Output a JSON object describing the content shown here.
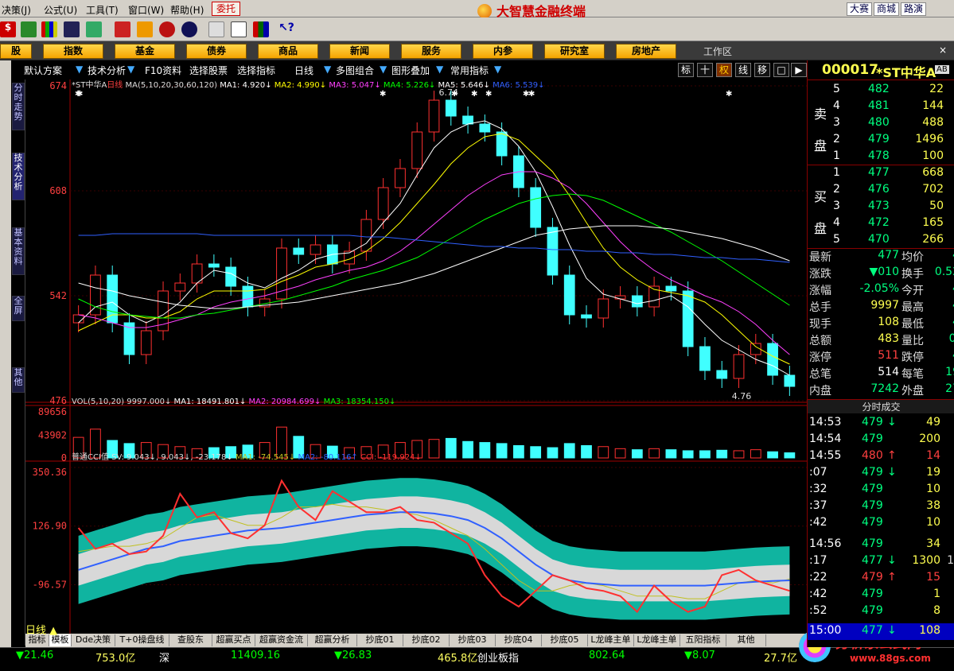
{
  "menu": {
    "items": [
      "决策(J)",
      "公式(U)",
      "工具(T)",
      "窗口(W)",
      "帮助(H)"
    ],
    "entrust": "委托",
    "brand": "大智慧金融终端",
    "right_buttons": [
      "大赛",
      "商城",
      "路演"
    ]
  },
  "nav": {
    "items": [
      "股",
      "指数",
      "基金",
      "债券",
      "商品",
      "新闻",
      "服务",
      "内参",
      "研究室",
      "房地产"
    ],
    "workarea": "工作区"
  },
  "subbar": {
    "items": [
      "默认方案",
      "技术分析",
      "F10资料",
      "选择股票",
      "选择指标",
      "日线",
      "多图组合",
      "图形叠加",
      "常用指标"
    ],
    "right_icons": [
      "标",
      "十",
      "权",
      "线",
      "移",
      "□",
      "▶"
    ]
  },
  "lefttabs": [
    "分时走势",
    "技术分析",
    "基本资料",
    "全屏",
    "其他"
  ],
  "chart": {
    "title_text": "*ST中华A",
    "period": "日线",
    "ma_header": "MA(5,10,20,30,60,120)",
    "ma_values": [
      {
        "label": "MA1: 4.920↓",
        "color": "#ffffff"
      },
      {
        "label": "MA2: 4.990↓",
        "color": "#ffff00"
      },
      {
        "label": "MA3: 5.047↓",
        "color": "#ff40ff"
      },
      {
        "label": "MA4: 5.226↓",
        "color": "#00ff00"
      },
      {
        "label": "MA5: 5.646↓",
        "color": "#ffffff"
      },
      {
        "label": "MA6: 5.539↓",
        "color": "#3060ff"
      }
    ],
    "price_axis": [
      "674",
      "608",
      "542",
      "476"
    ],
    "high_label": "6.74",
    "low_label": "4.76",
    "vol_header": "VOL(5,10,20)  9997.000↓",
    "vol_values": [
      {
        "label": "MA1: 18491.801↓",
        "color": "#ffffff"
      },
      {
        "label": "MA2: 20984.699↓",
        "color": "#ff40ff"
      },
      {
        "label": "MA3: 18354.150↓",
        "color": "#00ff00"
      }
    ],
    "vol_axis": [
      "89656",
      "43902",
      "0"
    ],
    "cci_header": "普通CCI值  SV: 9.043↓, 9.043↓, -23.178↓",
    "cci_values": [
      {
        "label": "MA1: -74.545↓",
        "color": "#c0c020"
      },
      {
        "label": "MA2: -80.116↑",
        "color": "#3060ff"
      },
      {
        "label": "CCI: -119.924↓",
        "color": "#ff3030"
      }
    ],
    "cci_axis": [
      "350.36",
      "126.90",
      "-96.57",
      "-316.37"
    ],
    "date_labels": [
      "2011/01",
      "02",
      "03",
      "04",
      "05",
      "06"
    ]
  },
  "chart_data": {
    "type": "line",
    "title": "*ST中华A 日线",
    "ylim": [
      4.76,
      6.74
    ],
    "close": [
      5.3,
      5.55,
      5.25,
      5.05,
      5.2,
      5.45,
      5.5,
      5.62,
      5.6,
      5.48,
      5.35,
      5.4,
      5.72,
      5.68,
      5.74,
      5.62,
      5.7,
      5.9,
      6.1,
      6.22,
      6.45,
      6.65,
      6.55,
      6.5,
      6.45,
      6.3,
      6.1,
      5.85,
      5.55,
      5.3,
      5.28,
      5.4,
      5.42,
      5.35,
      5.48,
      5.45,
      5.1,
      4.95,
      4.9,
      5.05,
      5.12,
      4.92,
      4.85
    ],
    "series": [
      {
        "name": "MA1",
        "values": [
          5.25,
          5.35,
          5.38,
          5.3,
          5.25,
          5.3,
          5.38,
          5.5,
          5.58,
          5.56,
          5.5,
          5.47,
          5.53,
          5.58,
          5.65,
          5.68,
          5.69,
          5.75,
          5.88,
          6.0,
          6.18,
          6.35,
          6.45,
          6.5,
          6.52,
          6.47,
          6.36,
          6.2,
          5.98,
          5.74,
          5.53,
          5.43,
          5.4,
          5.37,
          5.39,
          5.42,
          5.35,
          5.24,
          5.14,
          5.08,
          5.02,
          4.98,
          4.92
        ]
      },
      {
        "name": "MA2",
        "values": [
          5.2,
          5.25,
          5.3,
          5.3,
          5.28,
          5.28,
          5.32,
          5.4,
          5.45,
          5.45,
          5.45,
          5.46,
          5.51,
          5.55,
          5.6,
          5.62,
          5.65,
          5.7,
          5.78,
          5.88,
          6.0,
          6.12,
          6.25,
          6.35,
          6.42,
          6.44,
          6.4,
          6.3,
          6.2,
          6.05,
          5.88,
          5.72,
          5.6,
          5.52,
          5.46,
          5.44,
          5.42,
          5.38,
          5.3,
          5.2,
          5.1,
          5.04,
          4.99
        ]
      },
      {
        "name": "MA3",
        "values": [
          5.3,
          5.28,
          5.25,
          5.22,
          5.22,
          5.24,
          5.27,
          5.3,
          5.35,
          5.38,
          5.4,
          5.42,
          5.45,
          5.48,
          5.52,
          5.55,
          5.58,
          5.6,
          5.64,
          5.7,
          5.78,
          5.87,
          5.96,
          6.05,
          6.12,
          6.18,
          6.2,
          6.2,
          6.16,
          6.1,
          6.0,
          5.88,
          5.76,
          5.66,
          5.58,
          5.52,
          5.47,
          5.42,
          5.38,
          5.32,
          5.24,
          5.14,
          5.05
        ]
      },
      {
        "name": "MA4",
        "values": [
          5.4,
          5.35,
          5.32,
          5.3,
          5.29,
          5.28,
          5.28,
          5.3,
          5.31,
          5.33,
          5.35,
          5.37,
          5.39,
          5.42,
          5.45,
          5.48,
          5.52,
          5.55,
          5.58,
          5.62,
          5.66,
          5.72,
          5.78,
          5.84,
          5.9,
          5.95,
          6.0,
          6.03,
          6.05,
          6.06,
          6.05,
          6.02,
          5.97,
          5.92,
          5.87,
          5.82,
          5.76,
          5.7,
          5.64,
          5.57,
          5.5,
          5.43,
          5.36
        ]
      },
      {
        "name": "MA5",
        "values": [
          5.5,
          5.47,
          5.45,
          5.42,
          5.4,
          5.38,
          5.36,
          5.35,
          5.34,
          5.34,
          5.35,
          5.36,
          5.37,
          5.38,
          5.4,
          5.42,
          5.44,
          5.46,
          5.48,
          5.5,
          5.53,
          5.56,
          5.6,
          5.64,
          5.68,
          5.72,
          5.76,
          5.8,
          5.82,
          5.84,
          5.85,
          5.86,
          5.86,
          5.86,
          5.85,
          5.84,
          5.82,
          5.8,
          5.78,
          5.75,
          5.72,
          5.68,
          5.64
        ]
      },
      {
        "name": "MA6",
        "values": [
          5.8,
          5.8,
          5.81,
          5.81,
          5.81,
          5.81,
          5.81,
          5.81,
          5.8,
          5.8,
          5.8,
          5.8,
          5.8,
          5.8,
          5.8,
          5.8,
          5.8,
          5.79,
          5.79,
          5.78,
          5.77,
          5.76,
          5.75,
          5.74,
          5.73,
          5.73,
          5.72,
          5.72,
          5.71,
          5.71,
          5.7,
          5.7,
          5.69,
          5.69,
          5.68,
          5.68,
          5.67,
          5.66,
          5.66,
          5.65,
          5.65,
          5.64,
          5.63
        ]
      }
    ],
    "volume": [
      40000,
      56000,
      34000,
      28000,
      30000,
      26000,
      22000,
      18000,
      20000,
      22000,
      25000,
      30000,
      60000,
      42000,
      26000,
      23000,
      20000,
      22000,
      25000,
      30000,
      34000,
      36000,
      38000,
      32000,
      30000,
      28000,
      24000,
      22000,
      20000,
      28000,
      24000,
      22000,
      18000,
      16000,
      18000,
      16000,
      14000,
      14000,
      15000,
      14000,
      16000,
      12000,
      9997
    ],
    "volume_ylim": [
      0,
      89656
    ],
    "cci": [
      120,
      40,
      60,
      20,
      30,
      90,
      250,
      160,
      180,
      100,
      80,
      130,
      300,
      200,
      150,
      260,
      220,
      180,
      180,
      200,
      150,
      140,
      100,
      60,
      -60,
      -140,
      -180,
      -120,
      -60,
      -80,
      -110,
      -120,
      -140,
      -200,
      -100,
      -160,
      -200,
      -180,
      -60,
      -40,
      -80,
      -100,
      -120
    ],
    "cci_ma1": [
      30,
      40,
      50,
      50,
      60,
      80,
      120,
      160,
      170,
      150,
      130,
      130,
      160,
      200,
      200,
      210,
      200,
      200,
      190,
      180,
      170,
      150,
      120,
      90,
      40,
      -20,
      -80,
      -120,
      -120,
      -100,
      -90,
      -100,
      -120,
      -140,
      -140,
      -140,
      -150,
      -150,
      -120,
      -90,
      -80,
      -90,
      -75
    ],
    "cci_ma2": [
      -40,
      -20,
      0,
      20,
      40,
      50,
      70,
      80,
      90,
      100,
      110,
      115,
      120,
      130,
      140,
      150,
      160,
      170,
      175,
      180,
      180,
      175,
      165,
      150,
      120,
      80,
      30,
      -20,
      -60,
      -80,
      -90,
      -95,
      -100,
      -100,
      -100,
      -100,
      -100,
      -100,
      -95,
      -90,
      -85,
      -82,
      -80
    ],
    "cci_ylim": [
      -316.37,
      350.36
    ],
    "x_labels": [
      "2011/01",
      "02",
      "03",
      "04",
      "05",
      "06"
    ]
  },
  "quote": {
    "code": "000017",
    "name": "*ST中华A",
    "tag": "AB",
    "sell_label": [
      "卖",
      "盘"
    ],
    "buy_label": [
      "买",
      "盘"
    ],
    "sell": [
      {
        "lv": "5",
        "p": "482",
        "v": "22"
      },
      {
        "lv": "4",
        "p": "481",
        "v": "144"
      },
      {
        "lv": "3",
        "p": "480",
        "v": "488"
      },
      {
        "lv": "2",
        "p": "479",
        "v": "1496"
      },
      {
        "lv": "1",
        "p": "478",
        "v": "100"
      }
    ],
    "buy": [
      {
        "lv": "1",
        "p": "477",
        "v": "668"
      },
      {
        "lv": "2",
        "p": "476",
        "v": "702"
      },
      {
        "lv": "3",
        "p": "473",
        "v": "50"
      },
      {
        "lv": "4",
        "p": "472",
        "v": "165"
      },
      {
        "lv": "5",
        "p": "470",
        "v": "266"
      }
    ],
    "stats": [
      {
        "k1": "最新",
        "v1": "477",
        "k2": "均价",
        "v2": "4"
      },
      {
        "k1": "涨跌",
        "v1": "▼010",
        "k2": "换手",
        "v2": "0.52"
      },
      {
        "k1": "涨幅",
        "v1": "-2.05%",
        "k2": "今开",
        "v2": "4"
      },
      {
        "k1": "总手",
        "v1": "9997",
        "k2": "最高",
        "v2": "4"
      },
      {
        "k1": "现手",
        "v1": "108",
        "k2": "最低",
        "v2": "4"
      },
      {
        "k1": "总额",
        "v1": "483",
        "k2": "量比",
        "v2": "0."
      },
      {
        "k1": "涨停",
        "v1": "511",
        "k2": "跌停",
        "v2": "4"
      },
      {
        "k1": "总笔",
        "v1": "514",
        "k2": "每笔",
        "v2": "19"
      },
      {
        "k1": "内盘",
        "v1": "7242",
        "k2": "外盘",
        "v2": "27"
      }
    ],
    "ticks_header": "分时成交",
    "ticks": [
      {
        "t": "14:53",
        "p": "479",
        "a": "↓",
        "v": "49",
        "x": "1"
      },
      {
        "t": "14:54",
        "p": "479",
        "a": "",
        "v": "200",
        "x": "2"
      },
      {
        "t": "14:55",
        "p": "480",
        "a": "↑",
        "v": "14",
        "x": "2"
      },
      {
        "t": ":07",
        "p": "479",
        "a": "↓",
        "v": "19",
        "x": "2"
      },
      {
        "t": ":32",
        "p": "479",
        "a": "",
        "v": "10",
        "x": "3"
      },
      {
        "t": ":37",
        "p": "479",
        "a": "",
        "v": "38",
        "x": "1"
      },
      {
        "t": ":42",
        "p": "479",
        "a": "",
        "v": "10",
        "x": "1"
      },
      {
        "t": "14:56",
        "p": "479",
        "a": "",
        "v": "34",
        "x": "2"
      },
      {
        "t": ":17",
        "p": "477",
        "a": "↓",
        "v": "1300",
        "x": "18"
      },
      {
        "t": ":22",
        "p": "479",
        "a": "↑",
        "v": "15",
        "x": "1"
      },
      {
        "t": ":42",
        "p": "479",
        "a": "",
        "v": "1",
        "x": "1"
      },
      {
        "t": ":52",
        "p": "479",
        "a": "",
        "v": "8",
        "x": "1"
      },
      {
        "t": "15:00",
        "p": "477",
        "a": "↓",
        "v": "108",
        "x": "9"
      }
    ]
  },
  "bottom_tabs": [
    "指标",
    "模板",
    "Dde决策",
    "T+0操盘线",
    "查股东",
    "超赢买点",
    "超赢资金流",
    "超赢分析",
    "抄底01",
    "抄底02",
    "抄底03",
    "抄底04",
    "抄底05",
    "L龙峰主单1",
    "L龙峰主单2",
    "五阳指标",
    "其他"
  ],
  "status": {
    "items": [
      {
        "t": "▼21.46",
        "c": "#00ff00"
      },
      {
        "t": "753.0亿",
        "c": "#ffff60"
      },
      {
        "t": "深",
        "c": "#ffffff"
      },
      {
        "t": "11409.16",
        "c": "#00ff00"
      },
      {
        "t": "▼26.83",
        "c": "#00ff00"
      },
      {
        "t": "465.8亿",
        "c": "#ffff60"
      },
      {
        "t": "创业板指",
        "c": "#ffffff"
      },
      {
        "t": "802.64",
        "c": "#00ff00"
      },
      {
        "t": "▼8.07",
        "c": "#00ff00"
      },
      {
        "t": "27.7亿",
        "c": "#ffff60"
      }
    ],
    "watermark1": "分析家公式网",
    "watermark2": "www.88gs.com"
  }
}
